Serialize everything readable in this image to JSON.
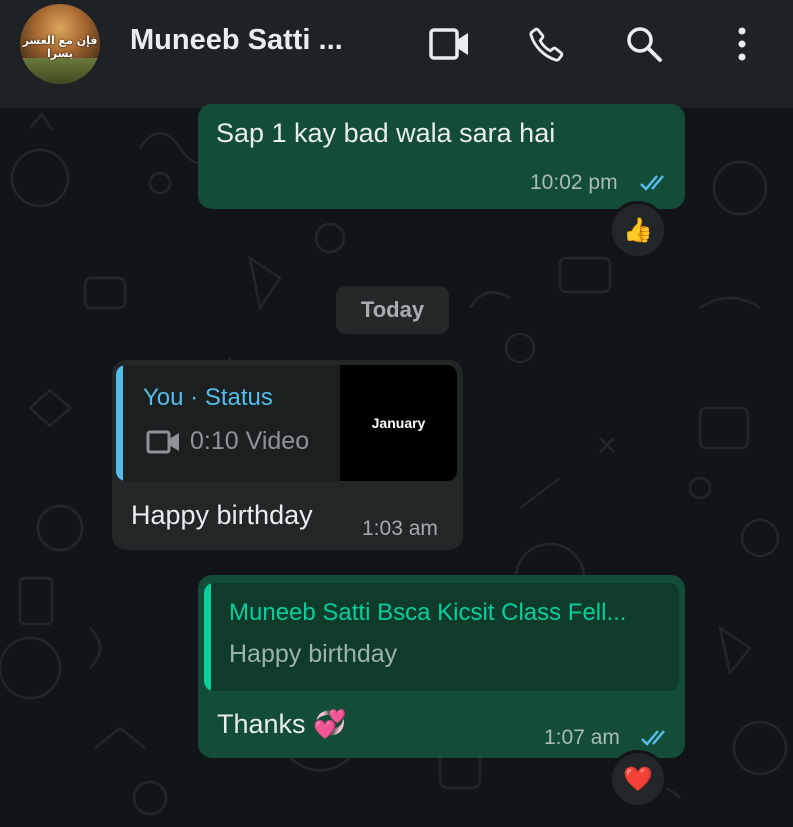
{
  "header": {
    "contact_name": "Muneeb Satti ...",
    "avatar_text": "فإن مع العسر يسرا",
    "icons": [
      "video-call-icon",
      "voice-call-icon",
      "search-icon",
      "more-options-icon"
    ]
  },
  "messages": [
    {
      "direction": "outgoing",
      "text": "Sap 1 kay bad wala sara hai",
      "time": "10:02 pm",
      "status": "read",
      "reaction": "👍"
    },
    {
      "type": "date-divider",
      "text": "Today"
    },
    {
      "direction": "incoming",
      "quoted": {
        "author": "You · Status",
        "media_label": "0:10 Video",
        "thumbnail_text": "January"
      },
      "text": "Happy birthday",
      "time": "1:03 am"
    },
    {
      "direction": "outgoing",
      "quoted": {
        "author": "Muneeb Satti Bsca Kicsit Class Fell...",
        "text": "Happy birthday"
      },
      "text": "Thanks 💞",
      "time": "1:07 am",
      "status": "read",
      "reaction": "❤️"
    }
  ],
  "colors": {
    "outgoing_bubble": "#134d37",
    "incoming_bubble": "#232627",
    "read_ticks": "#53bdeb",
    "status_quote_accent": "#53bdeb",
    "reply_quote_accent": "#06cf9c"
  }
}
